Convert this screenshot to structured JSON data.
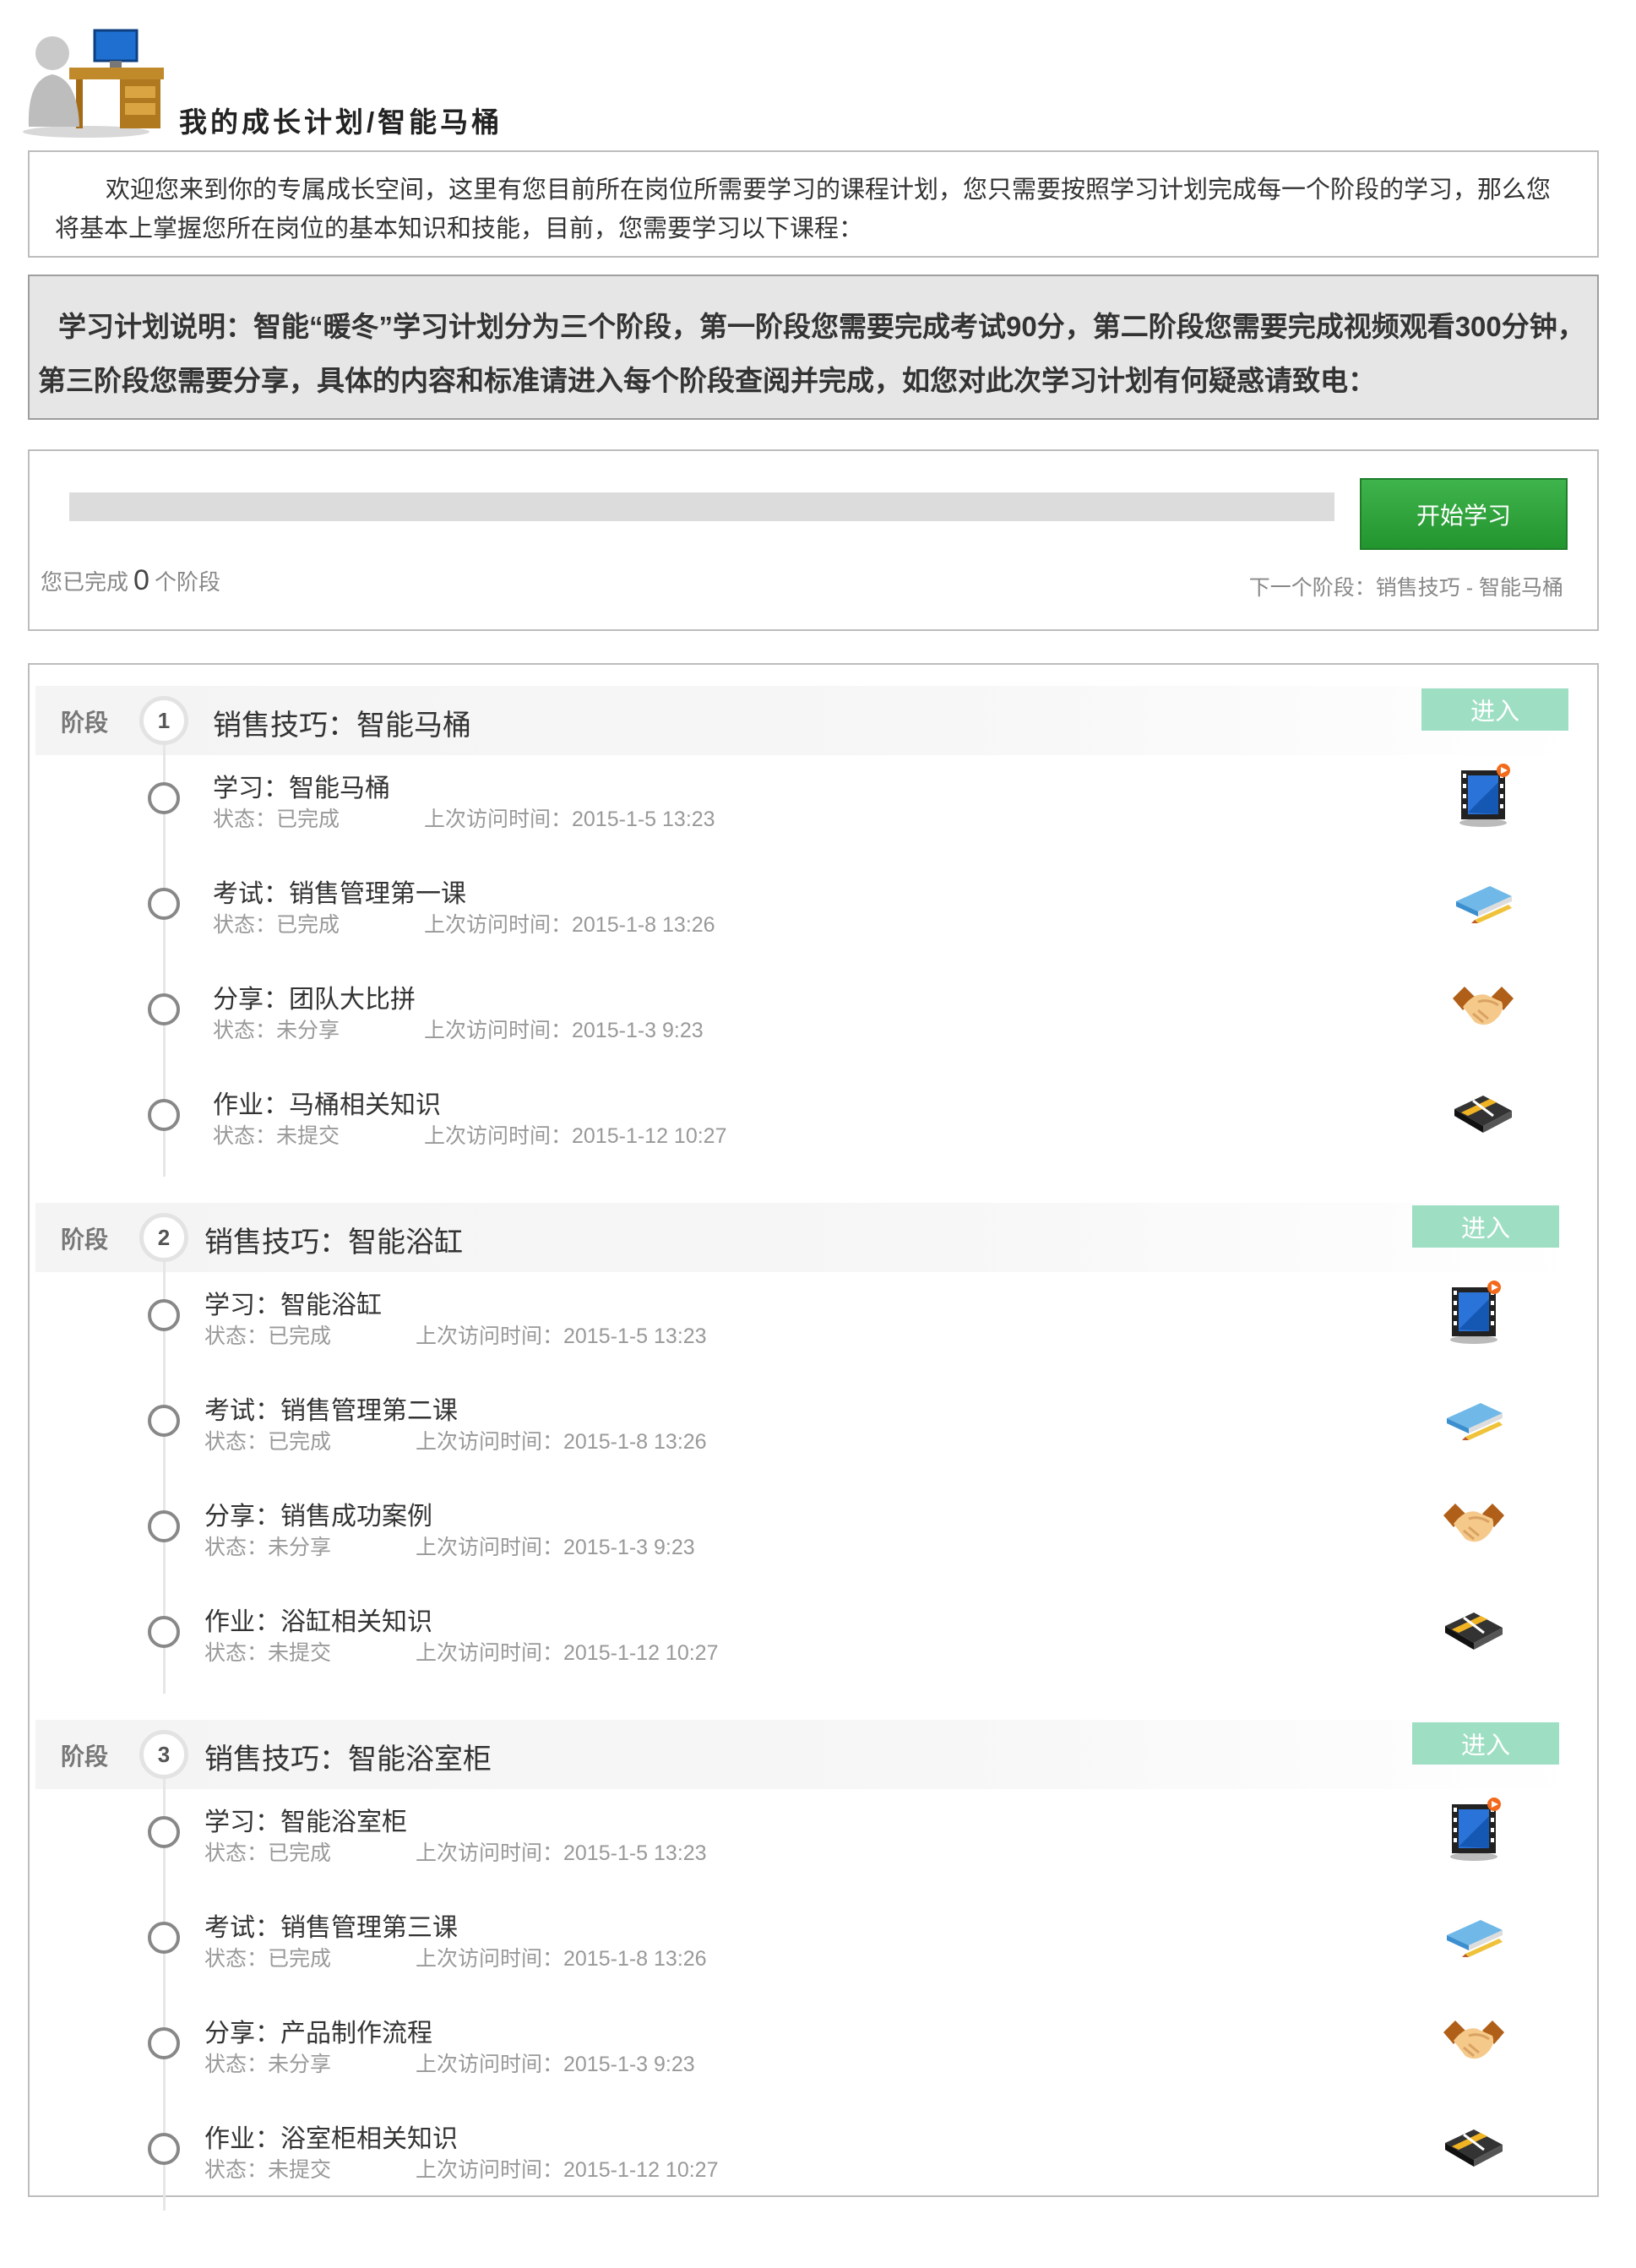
{
  "header": {
    "title": "我的成长计划/智能马桶"
  },
  "intro": {
    "text": "欢迎您来到你的专属成长空间，这里有您目前所在岗位所需要学习的课程计划，您只需要按照学习计划完成每一个阶段的学习，那么您将基本上掌握您所在岗位的基本知识和技能，目前，您需要学习以下课程："
  },
  "note": {
    "text": "学习计划说明：智能“暖冬”学习计划分为三个阶段，第一阶段您需要完成考试90分，第二阶段您需要完成视频观看300分钟，第三阶段您需要分享，具体的内容和标准请进入每个阶段查阅并完成，如您对此次学习计划有何疑惑请致电："
  },
  "progress": {
    "done_prefix": "您已完成",
    "done_count": "0",
    "done_suffix": "个阶段",
    "fraction": 0,
    "start_button": "开始学习",
    "next_stage": "下一个阶段：销售技巧 - 智能马桶"
  },
  "stage_label": "阶段",
  "enter_label": "进入",
  "stages": [
    {
      "num": "1",
      "title": "销售技巧：智能马桶",
      "items": [
        {
          "title": "学习：智能马桶",
          "status": "状态：已完成",
          "time": "上次访问时间：2015-1-5 13:23",
          "icon": "video-icon"
        },
        {
          "title": "考试：销售管理第一课",
          "status": "状态：已完成",
          "time": "上次访问时间：2015-1-8 13:26",
          "icon": "book-pencil-icon"
        },
        {
          "title": "分享：团队大比拼",
          "status": "状态：未分享",
          "time": "上次访问时间：2015-1-3 9:23",
          "icon": "handshake-icon"
        },
        {
          "title": "作业：马桶相关知识",
          "status": "状态：未提交",
          "time": "上次访问时间：2015-1-12 10:27",
          "icon": "notebook-icon"
        }
      ]
    },
    {
      "num": "2",
      "title": "销售技巧：智能浴缸",
      "items": [
        {
          "title": "学习：智能浴缸",
          "status": "状态：已完成",
          "time": "上次访问时间：2015-1-5 13:23",
          "icon": "video-icon"
        },
        {
          "title": "考试：销售管理第二课",
          "status": "状态：已完成",
          "time": "上次访问时间：2015-1-8 13:26",
          "icon": "book-pencil-icon"
        },
        {
          "title": "分享：销售成功案例",
          "status": "状态：未分享",
          "time": "上次访问时间：2015-1-3 9:23",
          "icon": "handshake-icon"
        },
        {
          "title": "作业：浴缸相关知识",
          "status": "状态：未提交",
          "time": "上次访问时间：2015-1-12 10:27",
          "icon": "notebook-icon"
        }
      ]
    },
    {
      "num": "3",
      "title": "销售技巧：智能浴室柜",
      "items": [
        {
          "title": "学习：智能浴室柜",
          "status": "状态：已完成",
          "time": "上次访问时间：2015-1-5 13:23",
          "icon": "video-icon"
        },
        {
          "title": "考试：销售管理第三课",
          "status": "状态：已完成",
          "time": "上次访问时间：2015-1-8 13:26",
          "icon": "book-pencil-icon"
        },
        {
          "title": "分享：产品制作流程",
          "status": "状态：未分享",
          "time": "上次访问时间：2015-1-3 9:23",
          "icon": "handshake-icon"
        },
        {
          "title": "作业：浴室柜相关知识",
          "status": "状态：未提交",
          "time": "上次访问时间：2015-1-12 10:27",
          "icon": "notebook-icon"
        }
      ]
    }
  ],
  "colors": {
    "accent_green": "#2aa83a",
    "enter_mint": "#9edfc4"
  }
}
